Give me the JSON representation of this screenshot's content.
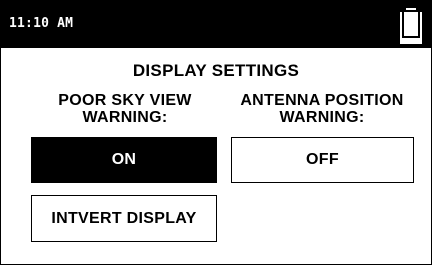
{
  "status_bar": {
    "time": "11:10 AM",
    "battery_icon": "battery-icon",
    "battery_level": 1.0
  },
  "screen": {
    "title": "DISPLAY SETTINGS",
    "poor_sky_view": {
      "label_line1": "POOR SKY VIEW",
      "label_line2": "WARNING:",
      "button_label": "ON",
      "state": "on"
    },
    "antenna_position": {
      "label_line1": "ANTENNA POSITION",
      "label_line2": "WARNING:",
      "button_label": "OFF",
      "state": "off"
    },
    "invert_display_label": "INTVERT DISPLAY"
  },
  "colors": {
    "background": "#ffffff",
    "foreground": "#000000"
  }
}
